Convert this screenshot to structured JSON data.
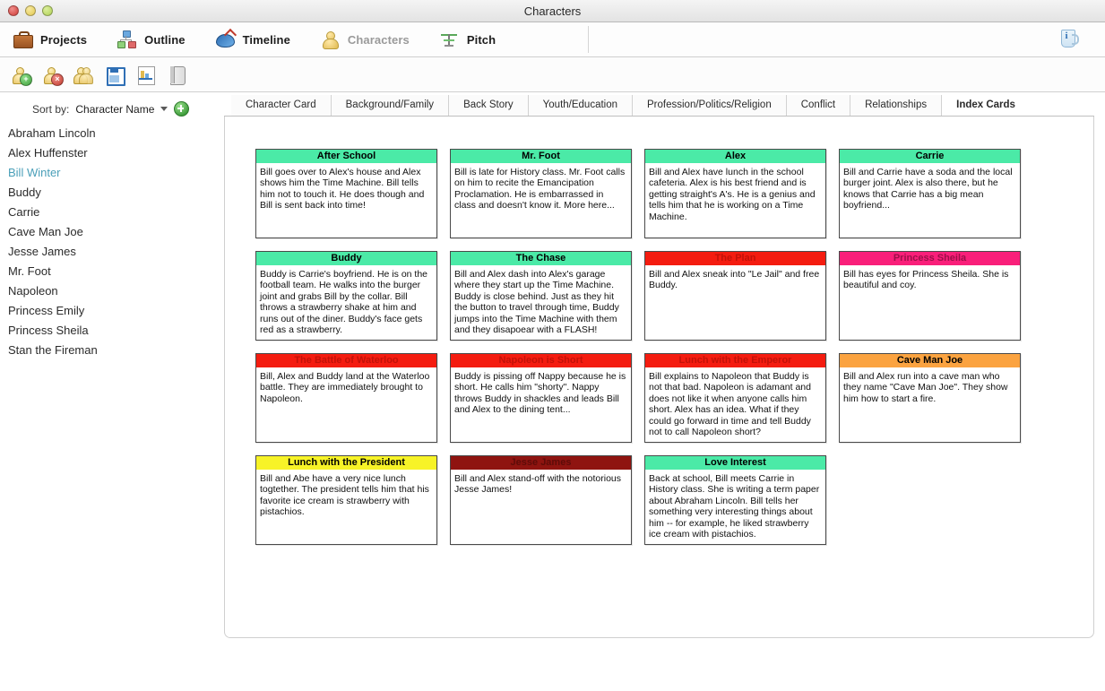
{
  "window": {
    "title": "Characters",
    "controls": [
      "close",
      "minimize",
      "zoom"
    ]
  },
  "modules": [
    {
      "label": "Projects",
      "icon": "briefcase-icon",
      "active": false
    },
    {
      "label": "Outline",
      "icon": "outline-tree-icon",
      "active": false
    },
    {
      "label": "Timeline",
      "icon": "timeline-swirl-icon",
      "active": false
    },
    {
      "label": "Characters",
      "icon": "character-bust-icon",
      "active": true
    },
    {
      "label": "Pitch",
      "icon": "pitch-icon",
      "active": false
    }
  ],
  "toolbar": {
    "buttons": [
      {
        "name": "add-character-button",
        "icon": "character-add-icon"
      },
      {
        "name": "delete-character-button",
        "icon": "character-delete-icon"
      },
      {
        "name": "duplicate-character-button",
        "icon": "character-duplicate-icon"
      },
      {
        "name": "save-button",
        "icon": "save-disk-icon"
      },
      {
        "name": "report-button",
        "icon": "report-chart-icon"
      },
      {
        "name": "library-button",
        "icon": "book-icon"
      }
    ],
    "info_button": {
      "name": "info-button",
      "icon": "info-icon",
      "glyph": "i"
    }
  },
  "sidebar": {
    "sort_label": "Sort by:",
    "sort_value": "Character Name",
    "add_button_label": "+",
    "characters": [
      {
        "name": "Abraham Lincoln",
        "selected": false
      },
      {
        "name": "Alex Huffenster",
        "selected": false
      },
      {
        "name": "Bill Winter",
        "selected": true
      },
      {
        "name": "Buddy",
        "selected": false
      },
      {
        "name": "Carrie",
        "selected": false
      },
      {
        "name": "Cave Man Joe",
        "selected": false
      },
      {
        "name": "Jesse James",
        "selected": false
      },
      {
        "name": "Mr. Foot",
        "selected": false
      },
      {
        "name": "Napoleon",
        "selected": false
      },
      {
        "name": "Princess Emily",
        "selected": false
      },
      {
        "name": "Princess Sheila",
        "selected": false
      },
      {
        "name": "Stan the Fireman",
        "selected": false
      }
    ]
  },
  "tabs": [
    {
      "label": "Character Card",
      "active": false
    },
    {
      "label": "Background/Family",
      "active": false
    },
    {
      "label": "Back Story",
      "active": false
    },
    {
      "label": "Youth/Education",
      "active": false
    },
    {
      "label": "Profession/Politics/Religion",
      "active": false
    },
    {
      "label": "Conflict",
      "active": false
    },
    {
      "label": "Relationships",
      "active": false
    },
    {
      "label": "Index Cards",
      "active": true
    }
  ],
  "cards": [
    {
      "title": "After School",
      "header_color": "#4beaa7",
      "title_color": "#000000",
      "text": "Bill goes over to Alex's house and Alex shows him the Time Machine. Bill tells him not to touch it. He does though and Bill is sent back into time!"
    },
    {
      "title": "Mr. Foot",
      "header_color": "#4beaa7",
      "title_color": "#000000",
      "text": "Bill is late for History class. Mr. Foot calls on him to recite the Emancipation Proclamation. He is embarrassed in class and doesn't know it. More here..."
    },
    {
      "title": "Alex",
      "header_color": "#4beaa7",
      "title_color": "#000000",
      "text": "Bill and Alex have lunch in the school cafeteria. Alex is his best friend and is getting straight's A's. He is a genius and tells him that he is working on a Time Machine."
    },
    {
      "title": "Carrie",
      "header_color": "#4beaa7",
      "title_color": "#000000",
      "text": "Bill and Carrie have a soda and the local burger joint. Alex is also there, but he knows that Carrie has a big mean boyfriend..."
    },
    {
      "title": "Buddy",
      "header_color": "#4beaa7",
      "title_color": "#000000",
      "text": "Buddy is Carrie's boyfriend. He is on the football team. He walks into the burger joint and grabs Bill by the collar. Bill throws a strawberry shake at him and runs out of the diner. Buddy's face gets red as a strawberry."
    },
    {
      "title": "The Chase",
      "header_color": "#4beaa7",
      "title_color": "#000000",
      "text": "Bill and Alex dash into Alex's garage where they start up the Time Machine. Buddy is close behind. Just as they hit the button to travel through time, Buddy jumps into the Time Machine with them and they disapoear with a FLASH!"
    },
    {
      "title": "The Plan",
      "header_color": "#f41c10",
      "title_color": "#c21208",
      "text": "Bill and Alex sneak into \"Le Jail\" and free Buddy."
    },
    {
      "title": "Princess Sheila",
      "header_color": "#f91f7a",
      "title_color": "#9c0f49",
      "text": "Bill has eyes for Princess Sheila. She is beautiful and coy."
    },
    {
      "title": "The Battle of Waterloo",
      "header_color": "#f41c10",
      "title_color": "#c21208",
      "text": "Bill, Alex and Buddy land at the Waterloo battle. They are immediately brought to Napoleon."
    },
    {
      "title": "Napoleon is Short",
      "header_color": "#f41c10",
      "title_color": "#c21208",
      "text": "Buddy is pissing off Nappy because he is short. He calls him \"shorty\". Nappy throws Buddy in shackles and leads Bill and Alex to the dining tent..."
    },
    {
      "title": "Lunch with the Emperor",
      "header_color": "#f41c10",
      "title_color": "#c21208",
      "text": "Bill explains to Napoleon that Buddy is not that bad. Napoleon is adamant and does not like it when anyone calls him short. Alex has an idea. What if they could go forward in time and tell Buddy not to call Napoleon short?"
    },
    {
      "title": "Cave Man Joe",
      "header_color": "#fba340",
      "title_color": "#000000",
      "text": "Bill and Alex run into a cave man who they name \"Cave Man Joe\". They show him how to start a fire."
    },
    {
      "title": "Lunch with the President",
      "header_color": "#f7f327",
      "title_color": "#000000",
      "text": "Bill and Abe have a very nice lunch togtether. The president tells him that his favorite ice cream is strawberry with pistachios."
    },
    {
      "title": "Jesse James",
      "header_color": "#8f1410",
      "title_color": "#5e0c09",
      "text": "Bill and Alex stand-off with the notorious Jesse James!"
    },
    {
      "title": "Love Interest",
      "header_color": "#4beaa7",
      "title_color": "#000000",
      "text": "Back at school, Bill meets Carrie in History class. She is writing a term paper about Abraham Lincoln. Bill tells her something very interesting things about him -- for example, he liked strawberry ice cream with pistachios."
    }
  ]
}
